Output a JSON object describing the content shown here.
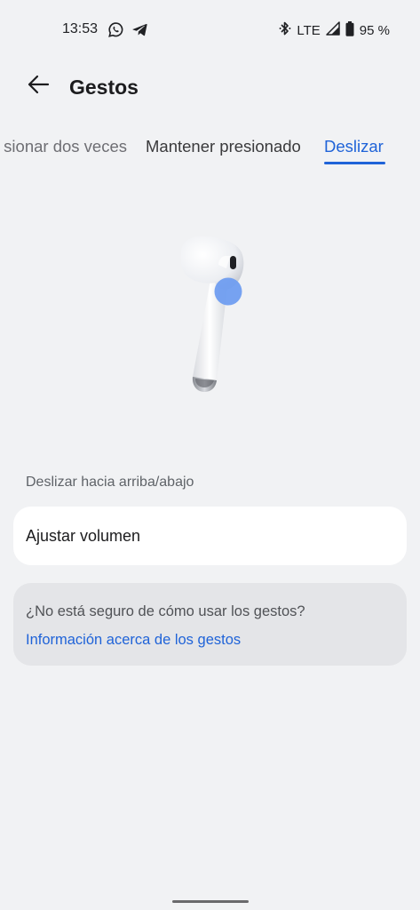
{
  "status_bar": {
    "time": "13:53",
    "network": "LTE",
    "battery": "95 %",
    "icons": [
      "whatsapp-icon",
      "telegram-icon",
      "bluetooth-icon",
      "signal-icon",
      "battery-icon"
    ]
  },
  "header": {
    "title": "Gestos",
    "back_icon": "arrow-left-icon"
  },
  "tabs": [
    {
      "label": "sionar dos veces",
      "selected": false
    },
    {
      "label": "Mantener presionado",
      "selected": false
    },
    {
      "label": "Deslizar",
      "selected": true
    }
  ],
  "gesture": {
    "section_label": "Deslizar hacia arriba/abajo",
    "action": "Ajustar volumen"
  },
  "help": {
    "question": "¿No está seguro de cómo usar los gestos?",
    "link": "Información acerca de los gestos"
  },
  "colors": {
    "accent": "#1f63d8",
    "background": "#f1f2f4",
    "card": "#ffffff",
    "help_card": "#e4e5e8",
    "touch_dot": "#6f9df0"
  }
}
